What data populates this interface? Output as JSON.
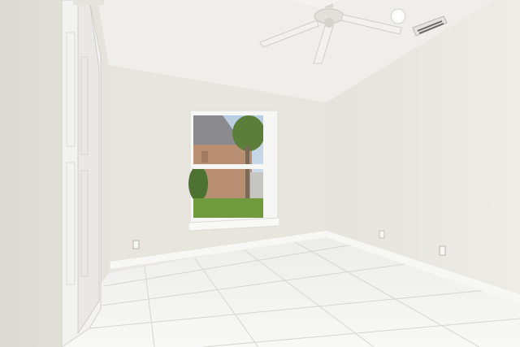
{
  "scene": {
    "subject": "empty-room-interior",
    "palette": {
      "ceiling": "#efeeea",
      "wall_left": "#e7e4dd",
      "wall_back": "#ebe8e1",
      "wall_right": "#e9e7e1",
      "floor": "#f3f3f1",
      "grout": "#d9d8d4",
      "baseboard": "#f7f7f5",
      "door": "#f2f2f0",
      "window_frame": "#f6f6f4",
      "sky": "#c9d8e8",
      "house_roof": "#8b8a8f",
      "house_wall": "#b88f73",
      "foliage": "#5b7f3a",
      "lawn": "#6f9a3e"
    },
    "icons": [
      "ceiling-fan-icon",
      "recessed-light-icon",
      "air-vent-icon",
      "wall-outlet-icon"
    ]
  }
}
